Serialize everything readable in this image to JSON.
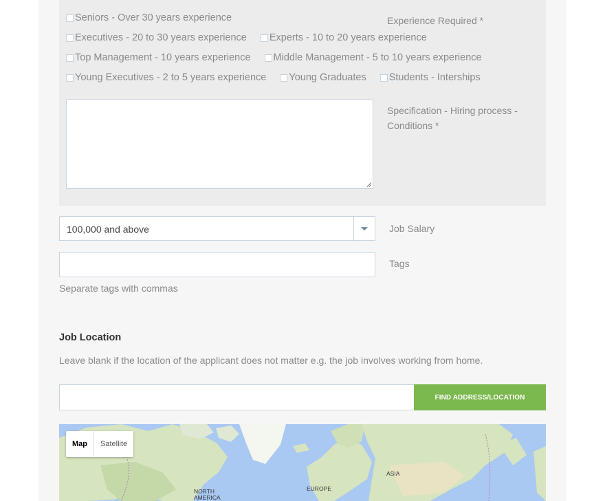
{
  "experience": {
    "label": "Experience Required *",
    "rows": [
      [
        "Seniors - Over 30 years experience"
      ],
      [
        "Executives - 20 to 30 years experience",
        "Experts - 10 to 20 years experience"
      ],
      [
        "Top Management - 10 years experience",
        "Middle Management - 5 to 10 years experience"
      ],
      [
        "Young Executives - 2 to 5 years experience",
        "Young Graduates",
        "Students - Interships"
      ]
    ]
  },
  "specification": {
    "label_line1": "Specification - Hiring process -",
    "label_line2": "Conditions *",
    "value": ""
  },
  "salary": {
    "label": "Job Salary",
    "selected": "100,000 and above"
  },
  "tags": {
    "label": "Tags",
    "value": "",
    "hint": "Separate tags with commas"
  },
  "location": {
    "title": "Job Location",
    "description": "Leave blank if the location of the applicant does not matter e.g. the job involves working from home.",
    "input_value": "",
    "button_label": "FIND ADDRESS/LOCATION"
  },
  "map": {
    "type_map": "Map",
    "type_satellite": "Satellite",
    "labels": {
      "north_america_1": "NORTH",
      "north_america_2": "AMERICA",
      "europe": "EUROPE",
      "asia": "ASIA"
    }
  },
  "colors": {
    "button_green": "#7bb84e",
    "panel_gray": "#ececec",
    "water": "#a9c8f2",
    "land": "#d6e4c0"
  }
}
